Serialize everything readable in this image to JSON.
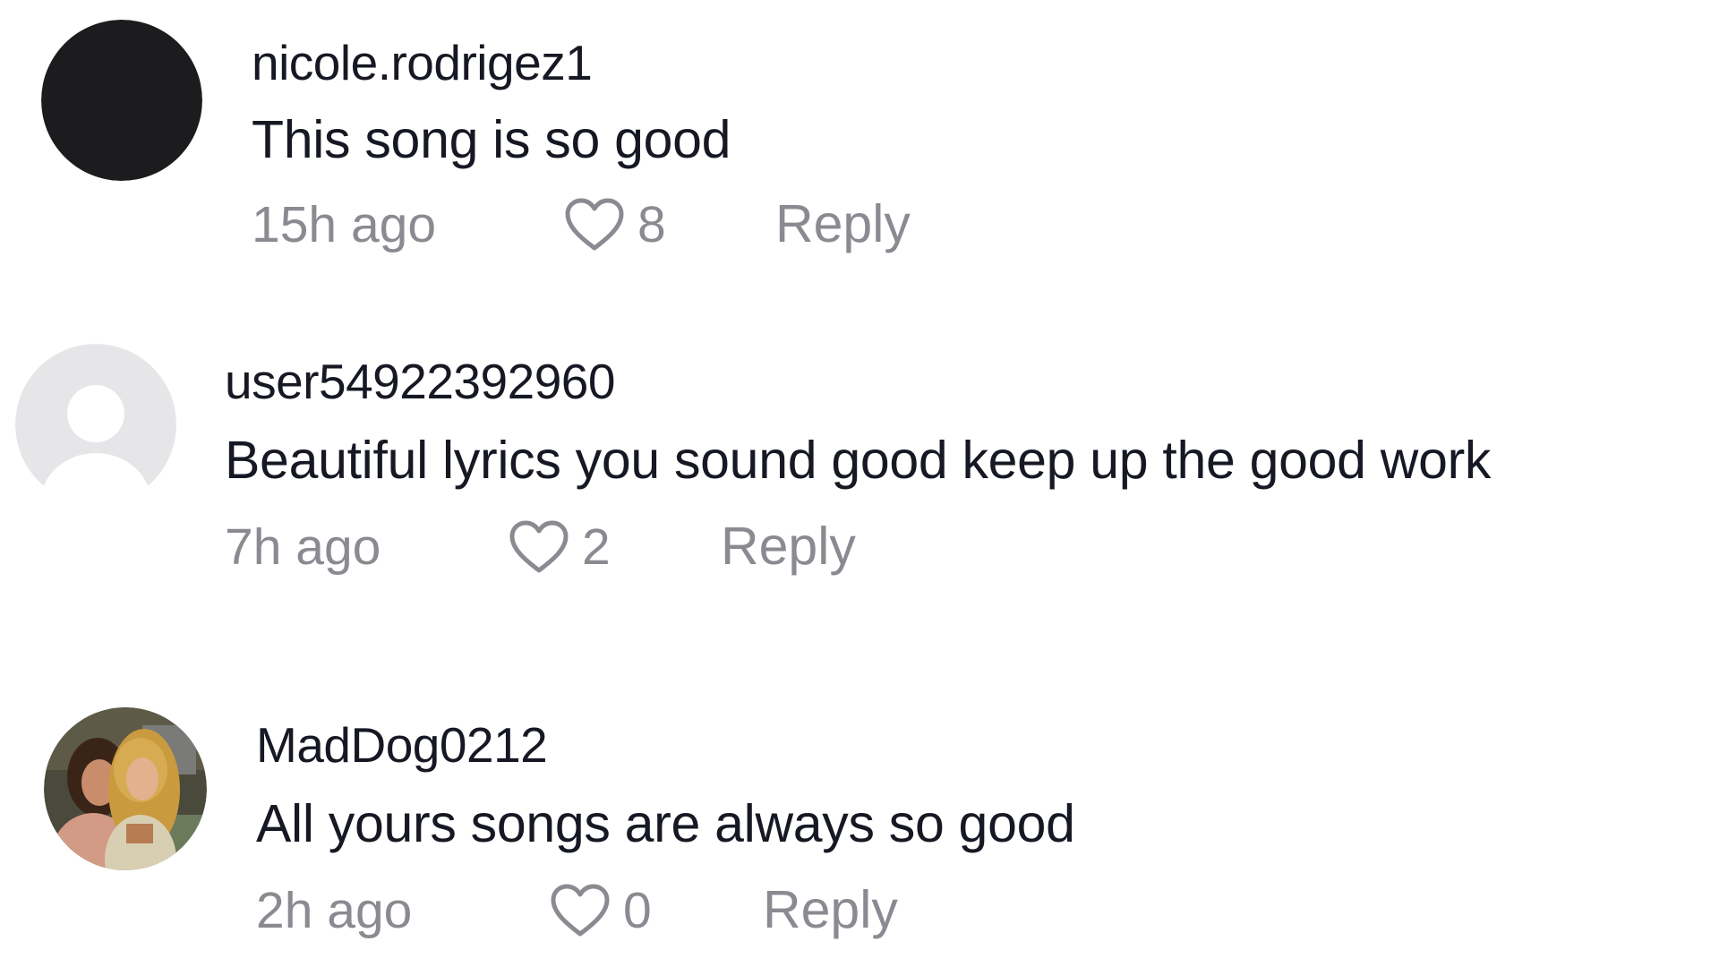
{
  "comments": [
    {
      "username": "nicole.rodrigez1",
      "text": "This song is so good",
      "time": "15h ago",
      "likes": "8",
      "reply_label": "Reply",
      "avatar": "solid-black-avatar"
    },
    {
      "username": "user54922392960",
      "text": "Beautiful lyrics you sound good keep up the good work",
      "time": "7h ago",
      "likes": "2",
      "reply_label": "Reply",
      "avatar": "default-person-avatar"
    },
    {
      "username": "MadDog0212",
      "text": "All yours songs are always so good",
      "time": "2h ago",
      "likes": "0",
      "reply_label": "Reply",
      "avatar": "photo-avatar"
    }
  ],
  "colors": {
    "text": "#161823",
    "muted": "#8a8b91",
    "default_avatar_bg": "#e6e6e8",
    "default_avatar_fg": "#ffffff"
  }
}
